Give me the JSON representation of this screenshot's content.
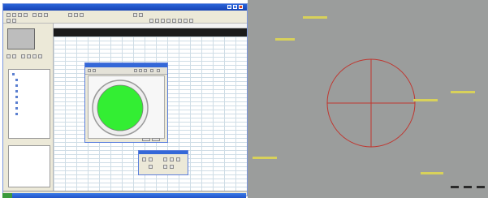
{
  "colors": {
    "window_border": "#7a96df",
    "titlebar": "#1f55c8",
    "spreadsheet_header": "#1b1b1b",
    "green_fill": "#33ee33",
    "camera_background": "#9b9d9c",
    "crosshair": "#c0362f",
    "label_yellow": "#d8d15a"
  },
  "icons": {
    "window_controls": [
      "minimize-icon",
      "maximize-icon",
      "close-icon"
    ],
    "toolbar": [
      "new-icon",
      "open-icon",
      "save-icon",
      "print-icon",
      "cut-icon",
      "copy-icon",
      "paste-icon",
      "undo-icon",
      "zoom-icon",
      "grid-icon",
      "chart-icon",
      "settings-icon"
    ],
    "toolbox": [
      "pointer-icon",
      "circle-icon",
      "line-icon",
      "measure-icon",
      "text-icon",
      "color-icon"
    ]
  }
}
